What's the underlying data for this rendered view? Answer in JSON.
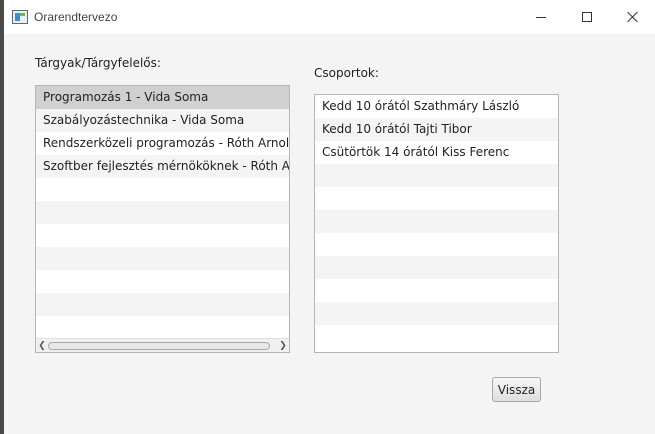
{
  "window": {
    "title": "Orarendtervezo",
    "controls": {
      "minimize": "minimize",
      "maximize": "maximize",
      "close": "close"
    }
  },
  "subjects": {
    "label": "Tárgyak/Tárgyfelelős:",
    "items": [
      "Programozás 1 - Vida Soma",
      "Szabályozástechnika - Vida Soma",
      "Rendszerközeli programozás - Róth Arnold",
      "Szoftber fejlesztés mérnököknek - Róth Arnold"
    ],
    "selected_index": 0,
    "empty_rows": 6
  },
  "groups": {
    "label": "Csoportok:",
    "items": [
      "Kedd 10 órától Szathmáry László",
      "Kedd 10 órától Tajti Tibor",
      "Csütörtök 14 órától Kiss Ferenc"
    ],
    "empty_rows": 8
  },
  "buttons": {
    "back": "Vissza"
  },
  "icons": {
    "app": "app-window-icon",
    "scroll_left": "chevron-left-icon",
    "scroll_right": "chevron-right-icon"
  }
}
